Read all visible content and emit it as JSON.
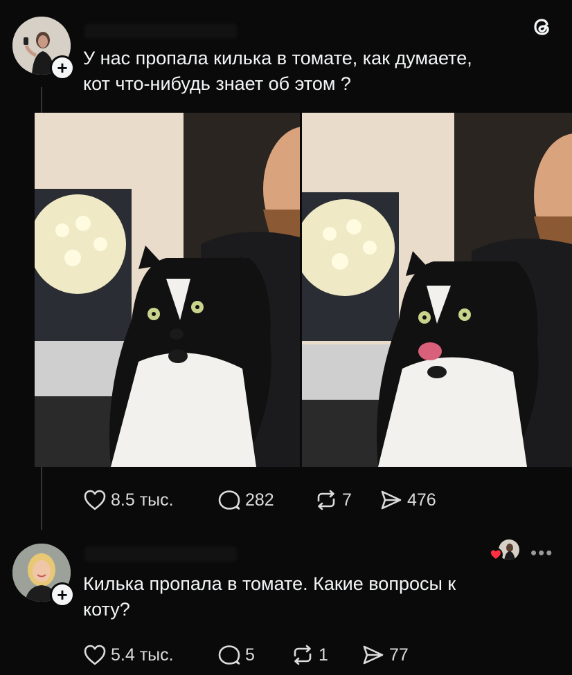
{
  "app": {
    "logo_icon": "threads-logo-icon"
  },
  "post": {
    "text": "У нас пропала килька в томате, как думаете,\nкот что-нибудь знает об этом ?",
    "images": [
      {
        "description_icon": "cat-photo-icon"
      },
      {
        "description_icon": "cat-licking-photo-icon"
      }
    ],
    "stats": {
      "likes": "8.5 тыс.",
      "replies": "282",
      "reposts": "7",
      "shares": "476"
    }
  },
  "reply": {
    "text": "Килька пропала в томате. Какие вопросы к\nкоту?",
    "stats": {
      "likes": "5.4 тыс.",
      "replies": "5",
      "reposts": "1",
      "shares": "77"
    },
    "more_label": "•••"
  },
  "colors": {
    "background": "#0a0a0a",
    "text": "#f3f5f7",
    "like_heart": "#ff3040"
  }
}
